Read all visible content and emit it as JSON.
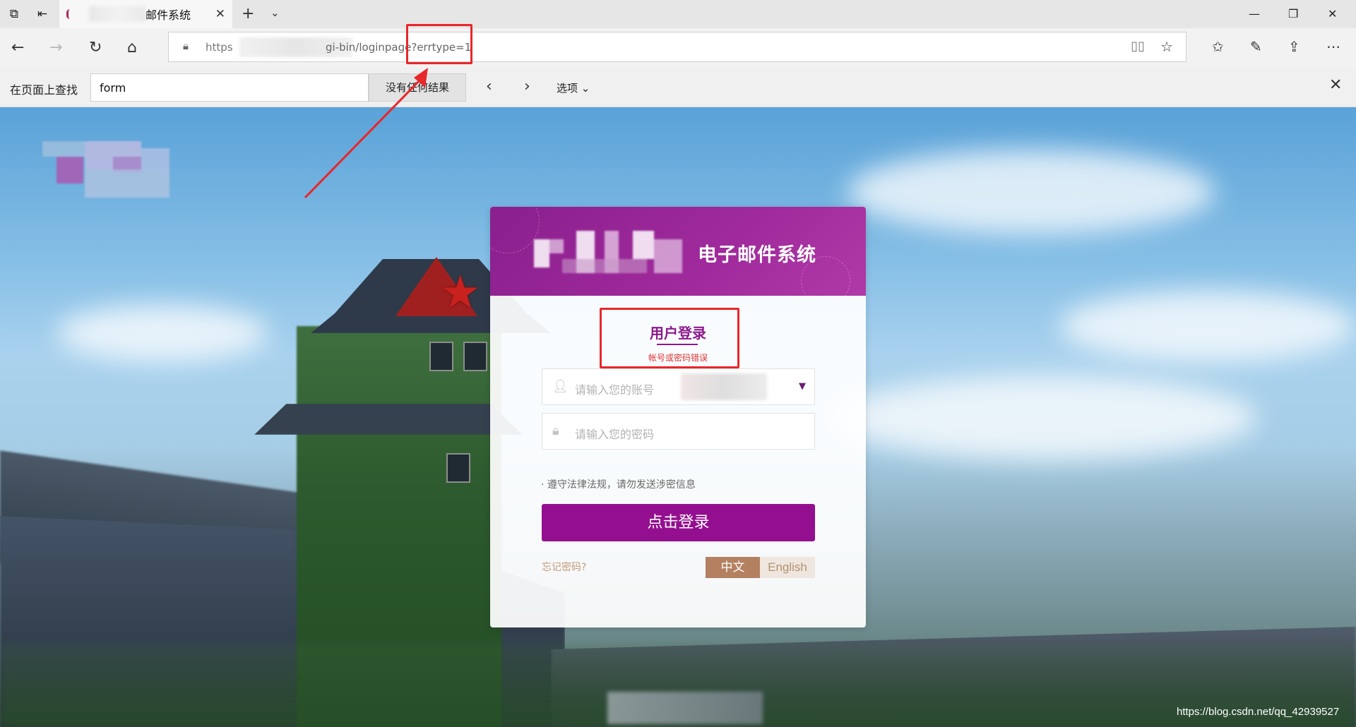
{
  "browser": {
    "tab": {
      "title": "邮件系统"
    },
    "address_bar": {
      "url_scheme": "https",
      "url_path": "gi-bin/loginpage?errtype=1"
    },
    "find_bar": {
      "label": "在页面上查找",
      "query": "form",
      "result": "没有任何结果",
      "options_label": "选项"
    }
  },
  "login_card": {
    "title": "电子邮件系统",
    "heading": "用户登录",
    "error_message": "帐号或密码错误",
    "username_placeholder": "请输入您的账号",
    "password_placeholder": "请输入您的密码",
    "notice": "· 遵守法律法规，请勿发送涉密信息",
    "login_button": "点击登录",
    "forgot_password": "忘记密码?",
    "languages": [
      "中文",
      "English"
    ],
    "selected_language": "中文"
  },
  "watermark": "https://blog.csdn.net/qq_42939527",
  "colors": {
    "brand_purple": "#940f8f",
    "error_red": "#e03333",
    "annotation_red": "#e8272a"
  }
}
